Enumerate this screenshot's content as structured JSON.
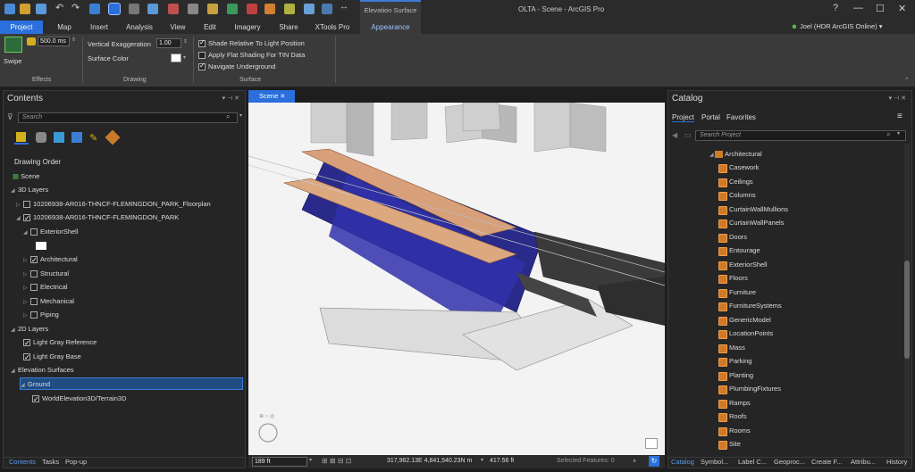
{
  "app": {
    "title": "OLTA - Scene - ArcGIS Pro",
    "context_band": "Elevation Surface",
    "user": "Joel (HDR ArcGIS Online)"
  },
  "ribbon_tabs": [
    "Project",
    "Map",
    "Insert",
    "Analysis",
    "View",
    "Edit",
    "Imagery",
    "Share",
    "XTools Pro",
    "Appearance"
  ],
  "ribbon": {
    "effects": {
      "swipe_label": "Swipe",
      "distance_value": "500.0",
      "distance_unit": "ms",
      "group": "Effects"
    },
    "drawing": {
      "vert_exag_label": "Vertical Exaggeration",
      "vert_exag_value": "1.00",
      "surface_color_label": "Surface Color",
      "group": "Drawing"
    },
    "surface": {
      "opt1": "Shade Relative To Light Position",
      "opt2": "Apply Flat Shading For TIN Data",
      "opt3": "Navigate Underground",
      "group": "Surface"
    }
  },
  "contents": {
    "title": "Contents",
    "search_placeholder": "Search",
    "drawing_order": "Drawing Order",
    "scene": "Scene",
    "layers_3d": "3D Layers",
    "floorplan": "10206938-AR016-THNCF-FLEMINGDON_PARK_Floorplan",
    "park": "10206938-AR016-THNCF-FLEMINGDON_PARK",
    "exterior": "ExteriorShell",
    "architectural": "Architectural",
    "structural": "Structural",
    "electrical": "Electrical",
    "mechanical": "Mechanical",
    "piping": "Piping",
    "layers_2d": "2D Layers",
    "light_ref": "Light Gray Reference",
    "light_base": "Light Gray Base",
    "elev_surfaces": "Elevation Surfaces",
    "ground": "Ground",
    "terrain": "WorldElevation3D/Terrain3D",
    "bottom_tabs": [
      "Contents",
      "Tasks",
      "Pop-up"
    ]
  },
  "scene": {
    "tab": "Scene",
    "scale": "189 ft",
    "coords": "317,962.13E 4,841,540.23N m",
    "elevation": "417.56 ft",
    "selected": "Selected Features: 0"
  },
  "catalog": {
    "title": "Catalog",
    "tabs": [
      "Project",
      "Portal",
      "Favorites"
    ],
    "search_placeholder": "Search Project",
    "folder": "Architectural",
    "items": [
      "Casework",
      "Ceilings",
      "Columns",
      "CurtainWallMullions",
      "CurtainWallPanels",
      "Doors",
      "Entourage",
      "ExteriorShell",
      "Floors",
      "Furniture",
      "FurnitureSystems",
      "GenericModel",
      "LocationPoints",
      "Mass",
      "Parking",
      "Planting",
      "PlumbingFixtures",
      "Ramps",
      "Roofs",
      "Rooms",
      "Site"
    ],
    "bottom_tabs": [
      "Catalog",
      "Symbol...",
      "Label C...",
      "Geoproc...",
      "Create F...",
      "Attribu...",
      "History"
    ]
  },
  "colors": {
    "accent": "#2a6fdb",
    "selection": "#1f4d82",
    "item_icon": "#d07a28"
  }
}
